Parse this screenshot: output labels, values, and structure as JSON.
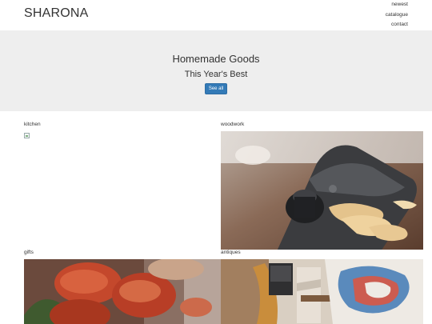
{
  "header": {
    "brand": "SHARONA",
    "nav": [
      "newest",
      "catalogue",
      "contact"
    ]
  },
  "hero": {
    "title": "Homemade Goods",
    "subtitle": "This Year's Best",
    "button_label": "See all"
  },
  "categories": [
    {
      "label": "kitchen",
      "image": "broken-image-icon"
    },
    {
      "label": "woodwork",
      "image": "hand-plane-photo"
    },
    {
      "label": "gifts",
      "image": "tulips-photo"
    },
    {
      "label": "antiques",
      "image": "vintage-tools-photo"
    }
  ],
  "colors": {
    "accent": "#337ab7",
    "hero_bg": "#eeeeee",
    "text": "#333333"
  }
}
